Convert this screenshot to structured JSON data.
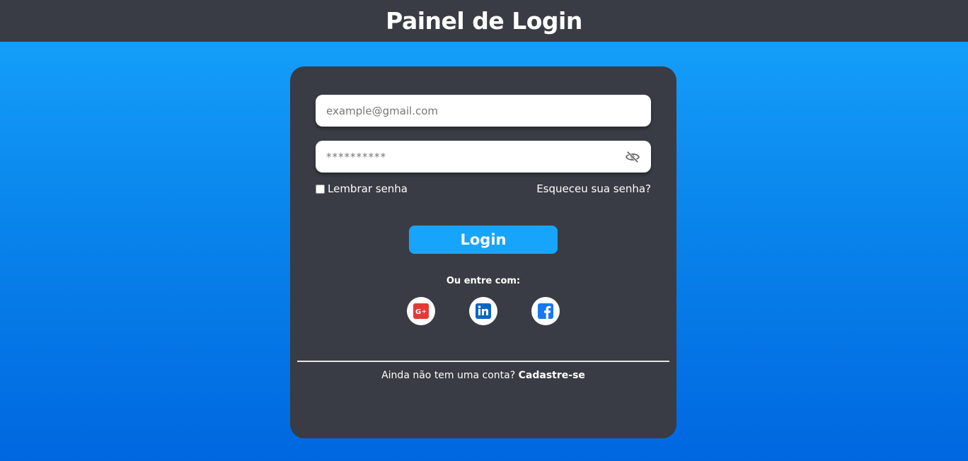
{
  "header": {
    "title": "Painel de Login"
  },
  "form": {
    "email_placeholder": "example@gmail.com",
    "password_placeholder": "**********",
    "remember_label": "Lembrar senha",
    "forgot_label": "Esqueceu sua senha?",
    "login_label": "Login"
  },
  "social": {
    "label": "Ou entre com:",
    "providers": [
      {
        "name": "google-plus-icon",
        "color": "#e53935"
      },
      {
        "name": "linkedin-icon",
        "color": "#0a66c2"
      },
      {
        "name": "facebook-icon",
        "color": "#1877f2"
      }
    ]
  },
  "footer": {
    "prompt": "Ainda não tem uma conta?",
    "signup_label": "Cadastre-se"
  },
  "colors": {
    "accent": "#17a4fd",
    "card": "#393c44",
    "gradient_top": "#17a4fd",
    "gradient_bottom": "#0067e0"
  }
}
